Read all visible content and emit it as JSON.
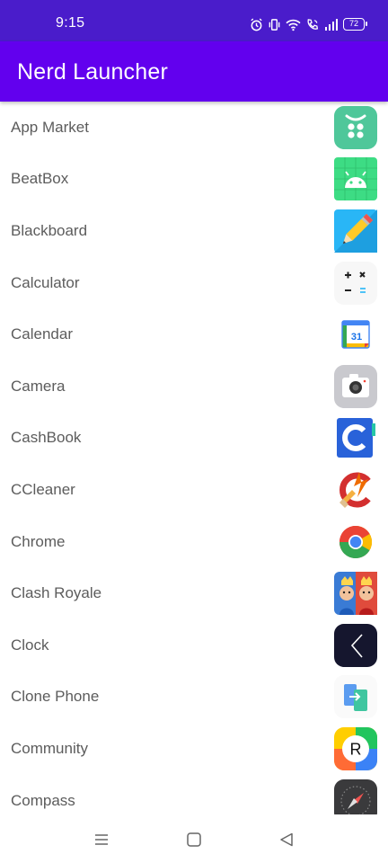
{
  "status_bar": {
    "time": "9:15",
    "battery": "72",
    "icons": [
      "alarm-icon",
      "vibrate-icon",
      "wifi-icon",
      "wifi-calling-icon",
      "signal-icon",
      "battery-icon"
    ]
  },
  "app_bar": {
    "title": "Nerd Launcher",
    "color": "#6200ee",
    "status_color": "#4a1ccb"
  },
  "apps": [
    {
      "label": "App Market",
      "icon": "app-market-icon"
    },
    {
      "label": "BeatBox",
      "icon": "android-icon"
    },
    {
      "label": "Blackboard",
      "icon": "pencil-icon"
    },
    {
      "label": "Calculator",
      "icon": "calculator-icon"
    },
    {
      "label": "Calendar",
      "icon": "calendar-icon",
      "icon_text": "31"
    },
    {
      "label": "Camera",
      "icon": "camera-icon"
    },
    {
      "label": "CashBook",
      "icon": "cashbook-icon"
    },
    {
      "label": "CCleaner",
      "icon": "ccleaner-icon"
    },
    {
      "label": "Chrome",
      "icon": "chrome-icon"
    },
    {
      "label": "Clash Royale",
      "icon": "clash-royale-icon"
    },
    {
      "label": "Clock",
      "icon": "clock-icon"
    },
    {
      "label": "Clone Phone",
      "icon": "clone-phone-icon"
    },
    {
      "label": "Community",
      "icon": "community-icon",
      "icon_text": "R"
    },
    {
      "label": "Compass",
      "icon": "compass-icon"
    }
  ],
  "nav_bar": {
    "buttons": [
      "menu-icon",
      "home-icon",
      "back-icon"
    ]
  }
}
